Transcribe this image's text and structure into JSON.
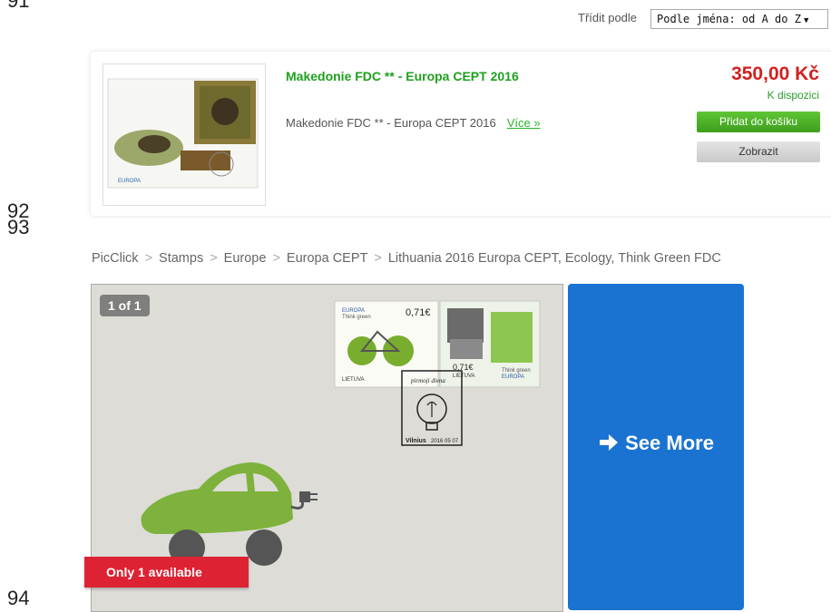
{
  "line_numbers": [
    "91",
    "92",
    "93",
    "94"
  ],
  "sort": {
    "label": "Třídit podle",
    "value": "Podle jména: od A do Z",
    "arrow": "▼"
  },
  "product": {
    "title": "Makedonie FDC ** - Europa CEPT 2016",
    "description": "Makedonie FDC ** - Europa CEPT 2016",
    "more_link": "Více »",
    "price": "350,00 Kč",
    "availability": "K dispozici",
    "add_to_cart": "Přidat do košíku",
    "view": "Zobrazit",
    "thumb_logo": "EUROPA"
  },
  "breadcrumb": {
    "items": [
      "PicClick",
      "Stamps",
      "Europe",
      "Europa CEPT",
      "Lithuania 2016 Europa CEPT, Ecology, Think Green FDC"
    ],
    "separator": ">"
  },
  "listing": {
    "image_counter": "1 of 1",
    "availability_badge": "Only 1 available",
    "see_more": "See More",
    "stamp1": {
      "brand": "EUROPA",
      "subtitle": "Think green",
      "value": "0,71€",
      "country": "LIETUVA"
    },
    "stamp2": {
      "value": "0,71€",
      "country": "LIETUVA",
      "subtitle": "Think green",
      "brand": "EUROPA"
    },
    "postmark": {
      "script": "pirmoji diena",
      "city": "Vilnius",
      "date": "2016 05 07"
    }
  },
  "colors": {
    "green_title": "#1ea01e",
    "price_red": "#d42020",
    "see_more_blue": "#1a73d1",
    "badge_red": "#dd2233"
  }
}
